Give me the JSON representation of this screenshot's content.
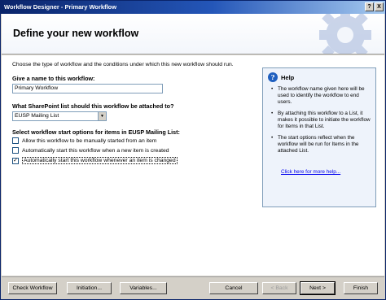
{
  "window": {
    "title": "Workflow Designer - Primary Workflow",
    "title_buttons": [
      "?",
      "X"
    ]
  },
  "banner": {
    "heading": "Define your new workflow"
  },
  "form": {
    "intro": "Choose the type of workflow and the conditions under which this new workflow should run.",
    "name_label": "Give a name to this workflow:",
    "name_value": "Primary Workflow",
    "list_label": "What SharePoint list should this workflow be attached to?",
    "list_value": "EUSP Mailing List",
    "start_label": "Select workflow start options for items in EUSP Mailing List:",
    "options": [
      {
        "label": "Allow this workflow to be manually started from an item",
        "checked": false,
        "mark": ""
      },
      {
        "label": "Automatically start this workflow when a new item is created",
        "checked": false,
        "mark": ""
      },
      {
        "label": "Automatically start this workflow whenever an item is changed",
        "checked": true,
        "mark": "✓"
      }
    ]
  },
  "help": {
    "title": "Help",
    "icon": "?",
    "bullets": [
      "The workflow name given here will be used to identify the workflow to end users.",
      "By attaching this workflow to a List, it makes it possible to initiate the workflow for Items in that List.",
      "The start options reflect when the workflow will be run for Items in the attached List."
    ],
    "link": "Click here for more help..."
  },
  "footer": {
    "check_workflow": "Check Workflow",
    "initiation": "Initiation...",
    "variables": "Variables...",
    "cancel": "Cancel",
    "back": "< Back",
    "next": "Next >",
    "finish": "Finish"
  }
}
